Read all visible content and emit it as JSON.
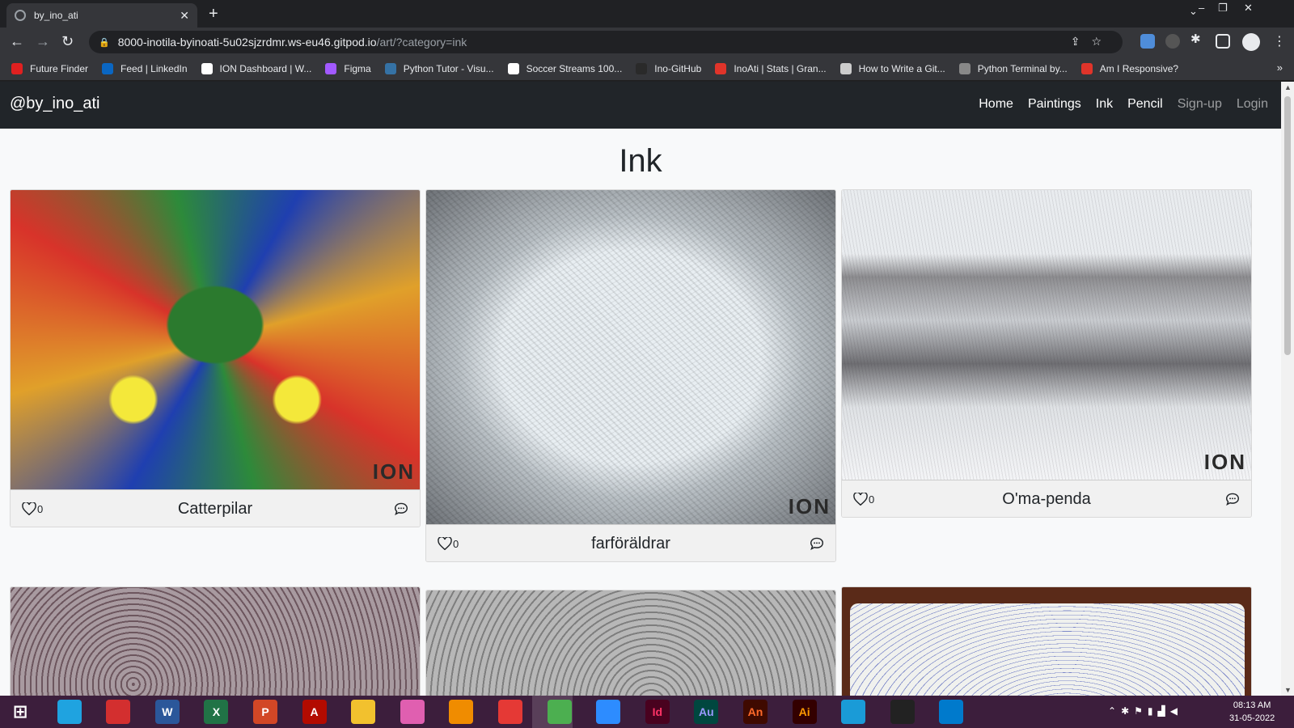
{
  "browser": {
    "tab_title": "by_ino_ati",
    "url_host": "8000-inotila-byinoati-5u02sjzrdmr.ws-eu46.gitpod.io",
    "url_path": "/art/?category=ink",
    "bookmarks": [
      {
        "label": "Future Finder",
        "color": "#e02020"
      },
      {
        "label": "Feed | LinkedIn",
        "color": "#0a66c2"
      },
      {
        "label": "ION Dashboard | W...",
        "color": "#ffffff"
      },
      {
        "label": "Figma",
        "color": "#a259ff"
      },
      {
        "label": "Python Tutor - Visu...",
        "color": "#3572a5"
      },
      {
        "label": "Soccer Streams 100...",
        "color": "#ffffff"
      },
      {
        "label": "Ino-GitHub",
        "color": "#2a2a2a"
      },
      {
        "label": "InoAti | Stats | Gran...",
        "color": "#e0342a"
      },
      {
        "label": "How to Write a Git...",
        "color": "#cccccc"
      },
      {
        "label": "Python Terminal by...",
        "color": "#888888"
      },
      {
        "label": "Am I Responsive?",
        "color": "#e0342a"
      }
    ]
  },
  "site": {
    "brand": "@by_ino_ati",
    "nav": [
      {
        "label": "Home",
        "muted": false
      },
      {
        "label": "Paintings",
        "muted": false
      },
      {
        "label": "Ink",
        "muted": false
      },
      {
        "label": "Pencil",
        "muted": false
      },
      {
        "label": "Sign-up",
        "muted": true
      },
      {
        "label": "Login",
        "muted": true
      }
    ],
    "heading": "Ink"
  },
  "cards": [
    {
      "title": "Catterpilar",
      "likes": "0",
      "watermark": "ION"
    },
    {
      "title": "farföräldrar",
      "likes": "0",
      "watermark": "ION"
    },
    {
      "title": "O'ma-penda",
      "likes": "0",
      "watermark": "ION"
    }
  ],
  "taskbar": {
    "time": "08:13 AM",
    "date": "31-05-2022",
    "apps": [
      "windows",
      "sync",
      "clipboard",
      "word",
      "excel",
      "powerpoint",
      "acrobat",
      "explorer",
      "itunes",
      "vlc",
      "screenrec",
      "chrome",
      "zoom",
      "indesign",
      "audition",
      "animate",
      "illustrator",
      "edge",
      "inkscape",
      "vscode"
    ],
    "app_labels": {
      "word": "W",
      "excel": "X",
      "powerpoint": "P",
      "acrobat": "A",
      "indesign": "Id",
      "audition": "Au",
      "animate": "An",
      "illustrator": "Ai"
    }
  }
}
